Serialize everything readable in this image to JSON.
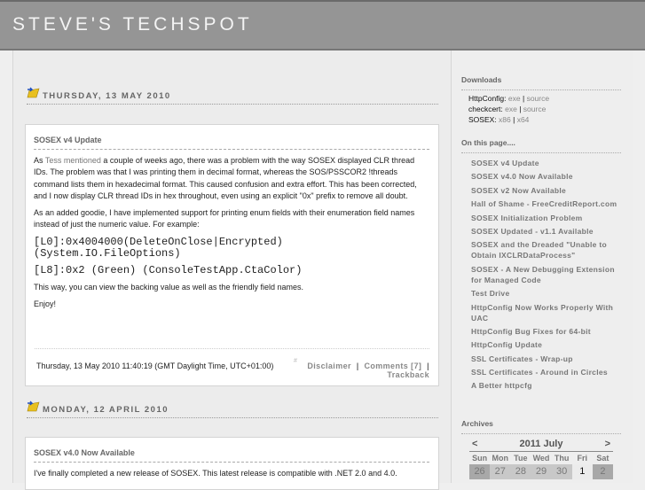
{
  "header": {
    "title": "STEVE'S TECHSPOT"
  },
  "posts": [
    {
      "date": "THURSDAY, 13 MAY 2010",
      "title": "SOSEX v4 Update",
      "p1_pre": "As ",
      "p1_link": "Tess mentioned",
      "p1_post": " a couple of weeks ago, there was a problem with the way SOSEX displayed CLR thread IDs.  The problem was that I was printing them in decimal format, whereas the SOS/PSSCOR2 !threads command lists them in hexadecimal format.  This caused confusion and extra effort.  This has been corrected, and I now display CLR thread IDs in hex throughout, even using an explicit \"0x\" prefix to remove all doubt.",
      "p2": "As an added goodie, I have implemented support for printing enum fields with their enumeration field names instead of just the numeric value.  For example:",
      "code1": "[L0]:0x4004000(DeleteOnClose|Encrypted)\n(System.IO.FileOptions)",
      "code2": "[L8]:0x2 (Green) (ConsoleTestApp.CtaColor)",
      "p3": "This way, you can view the backing value as well as the friendly field names.",
      "p4": "Enjoy!",
      "timestamp": "Thursday, 13 May 2010 11:40:19 (GMT Daylight Time, UTC+01:00)",
      "permalink": "#",
      "disclaimer": "Disclaimer",
      "sep": "|",
      "comments": "Comments [7]",
      "trackback": "Trackback"
    },
    {
      "date": "MONDAY, 12 APRIL 2010",
      "title": "SOSEX v4.0 Now Available",
      "p1": "I've finally completed a new release of SOSEX.  This latest release is compatible with .NET 2.0 and 4.0."
    }
  ],
  "sidebar": {
    "downloads_title": "Downloads",
    "downloads": [
      {
        "name": "HttpConfig:",
        "l1": "exe",
        "l2": "source"
      },
      {
        "name": "checkcert:",
        "l1": "exe",
        "l2": "source"
      },
      {
        "name": "SOSEX:",
        "l1": "x86",
        "l2": "x64"
      }
    ],
    "onpage_title": "On this page....",
    "onpage": [
      "SOSEX v4 Update",
      "SOSEX v4.0 Now Available",
      "SOSEX v2 Now Available",
      "Hall of Shame - FreeCreditReport.com",
      "SOSEX Initialization Problem",
      "SOSEX Updated - v1.1 Available",
      "SOSEX and the Dreaded \"Unable to Obtain IXCLRDataProcess\"",
      "SOSEX - A New Debugging Extension for Managed Code",
      "Test Drive",
      "HttpConfig Now Works Properly With UAC",
      "HttpConfig Bug Fixes for 64-bit",
      "HttpConfig Update",
      "SSL Certificates - Wrap-up",
      "SSL Certificates - Around in Circles",
      "A Better httpcfg"
    ],
    "archives_title": "Archives",
    "calendar": {
      "prev": "<",
      "title": "2011 July",
      "next": ">",
      "days": [
        "Sun",
        "Mon",
        "Tue",
        "Wed",
        "Thu",
        "Fri",
        "Sat"
      ],
      "week1": [
        "26",
        "27",
        "28",
        "29",
        "30",
        "1",
        "2"
      ]
    }
  }
}
